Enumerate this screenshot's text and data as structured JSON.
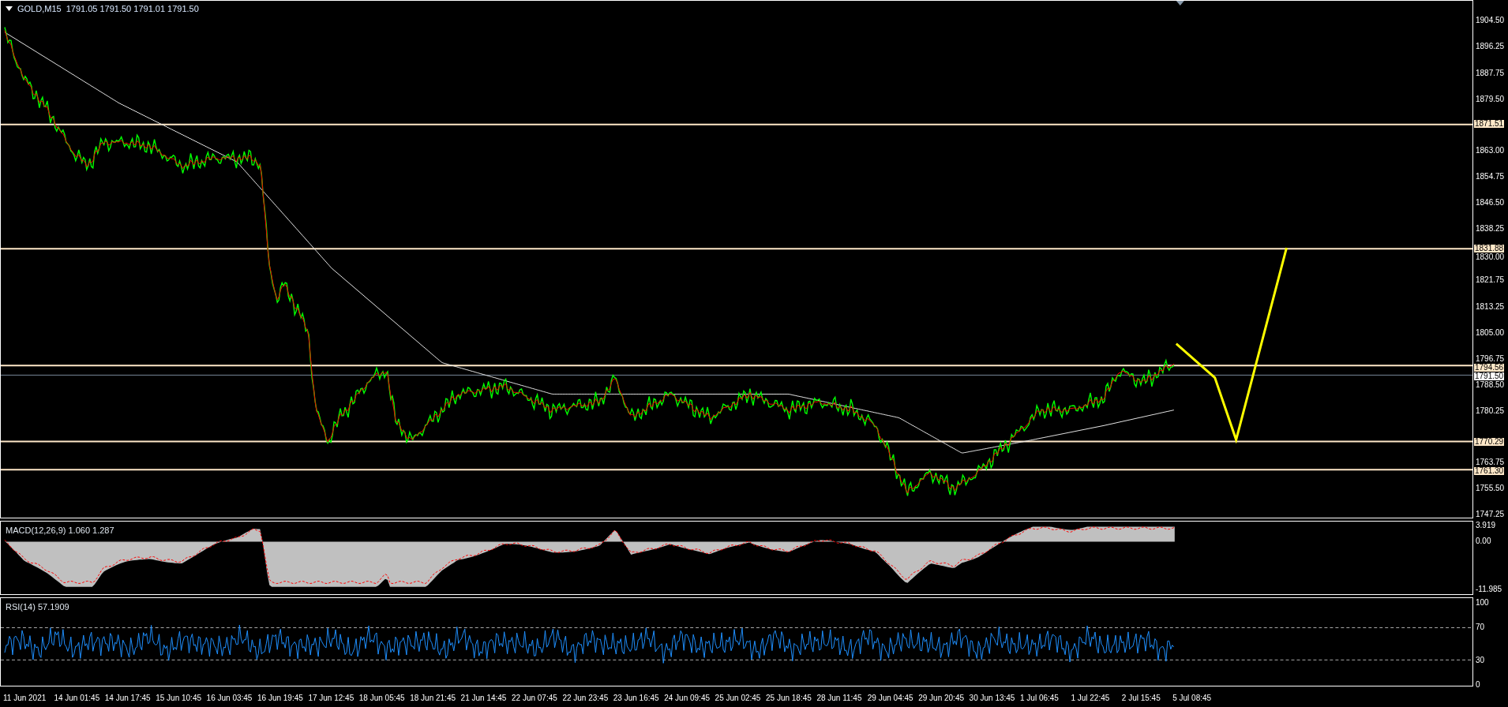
{
  "header": {
    "symbol": "GOLD,M15",
    "ohlc": "1791.05 1791.50 1791.01 1791.50"
  },
  "price_axis": {
    "ticks": [
      "1904.50",
      "1896.25",
      "1887.75",
      "1879.50",
      "1863.00",
      "1854.75",
      "1846.50",
      "1838.25",
      "1830.00",
      "1821.75",
      "1813.25",
      "1805.00",
      "1796.75",
      "1788.50",
      "1780.25",
      "1763.75",
      "1755.50",
      "1747.25"
    ],
    "levels": [
      {
        "label": "1871.51",
        "kind": "level"
      },
      {
        "label": "1831.88",
        "kind": "level"
      },
      {
        "label": "1794.56",
        "kind": "level"
      },
      {
        "label": "1791.50",
        "kind": "bid"
      },
      {
        "label": "1770.29",
        "kind": "level"
      },
      {
        "label": "1761.30",
        "kind": "level"
      }
    ]
  },
  "macd": {
    "label": "MACD(12,26,9) 1.060 1.287",
    "ticks": [
      "3.919",
      "0.00",
      "-11.985"
    ]
  },
  "rsi": {
    "label": "RSI(14) 57.1909",
    "ticks": [
      "100",
      "70",
      "30",
      "0"
    ]
  },
  "time_axis": {
    "labels": [
      "11 Jun 2021",
      "14 Jun 01:45",
      "14 Jun 17:45",
      "15 Jun 10:45",
      "16 Jun 03:45",
      "16 Jun 19:45",
      "17 Jun 12:45",
      "18 Jun 05:45",
      "18 Jun 21:45",
      "21 Jun 14:45",
      "22 Jun 07:45",
      "22 Jun 23:45",
      "23 Jun 16:45",
      "24 Jun 09:45",
      "25 Jun 02:45",
      "25 Jun 18:45",
      "28 Jun 11:45",
      "29 Jun 04:45",
      "29 Jun 20:45",
      "30 Jun 13:45",
      "1 Jul 06:45",
      "1 Jul 22:45",
      "2 Jul 15:45",
      "5 Jul 08:45"
    ]
  }
}
